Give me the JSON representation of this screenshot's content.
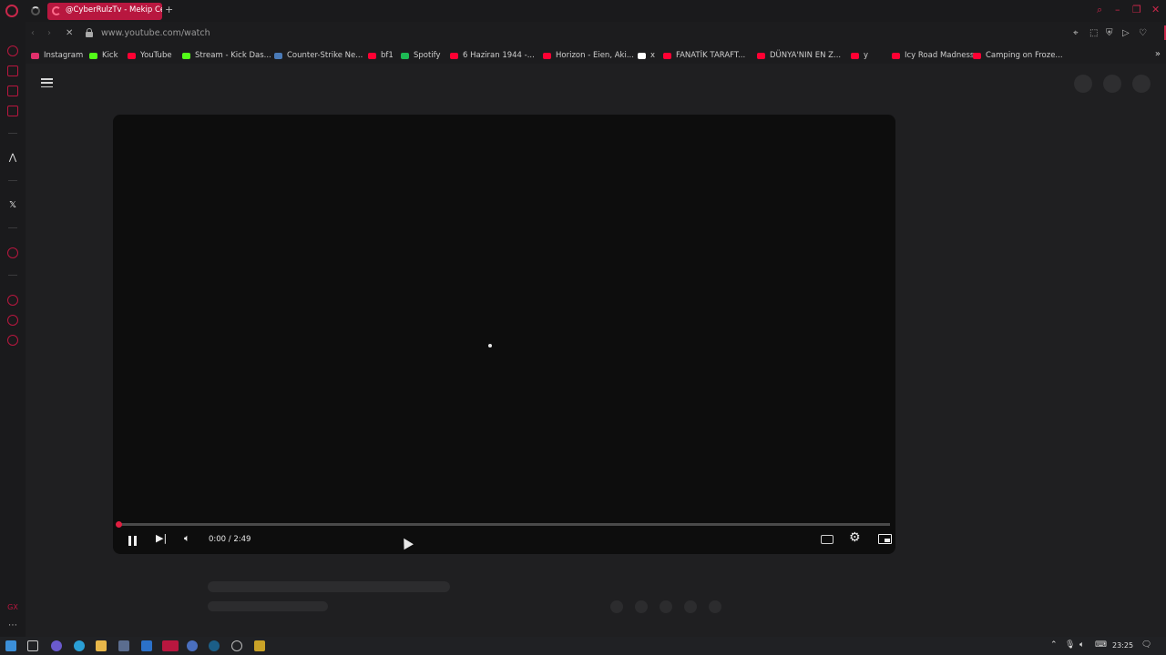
{
  "tab": {
    "title": "@CyberRulzTv - Mekip Ce",
    "new_tab_symbol": "+"
  },
  "address": {
    "url": "www.youtube.com/watch"
  },
  "bookmarks": [
    {
      "label": "Instagram",
      "icon": "instagram-icon",
      "color": "#e1306c"
    },
    {
      "label": "Kick",
      "icon": "kick-icon",
      "color": "#53fc18"
    },
    {
      "label": "YouTube",
      "icon": "youtube-icon",
      "color": "#ff0033"
    },
    {
      "label": "Stream - Kick Das...",
      "icon": "kick-icon",
      "color": "#53fc18"
    },
    {
      "label": "Counter-Strike Ne...",
      "icon": "counter-strike-icon",
      "color": "#4a7ab7"
    },
    {
      "label": "bf1",
      "icon": "youtube-icon",
      "color": "#ff0033"
    },
    {
      "label": "Spotify",
      "icon": "spotify-icon",
      "color": "#1db954"
    },
    {
      "label": "6 Haziran 1944 -...",
      "icon": "youtube-icon",
      "color": "#ff0033"
    },
    {
      "label": "Horizon - Eien, Aki...",
      "icon": "youtube-icon",
      "color": "#ff0033"
    },
    {
      "label": "x",
      "icon": "x-icon",
      "color": "#ffffff"
    },
    {
      "label": "FANATİK TARAFT...",
      "icon": "youtube-icon",
      "color": "#ff0033"
    },
    {
      "label": "DÜNYA'NIN EN Z...",
      "icon": "youtube-icon",
      "color": "#ff0033"
    },
    {
      "label": "y",
      "icon": "youtube-icon",
      "color": "#ff0033"
    },
    {
      "label": "Icy Road Madness...",
      "icon": "youtube-icon",
      "color": "#ff0033"
    },
    {
      "label": "Camping on Froze...",
      "icon": "youtube-icon",
      "color": "#ff0033"
    }
  ],
  "player": {
    "time": "0:00 / 2:49",
    "progress": 0.0
  },
  "taskbar": {
    "clock": "23:25"
  },
  "colors": {
    "accent": "#c8274a",
    "progress": "#e01e40"
  }
}
